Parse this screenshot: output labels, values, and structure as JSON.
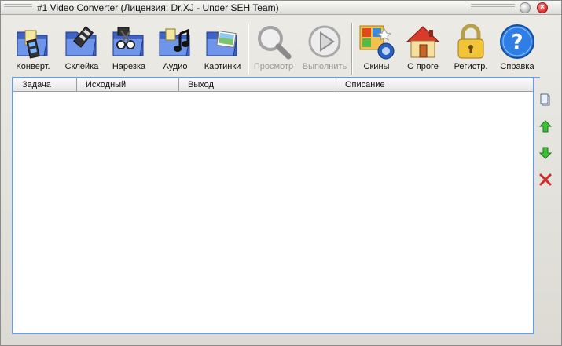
{
  "window": {
    "title": "#1 Video Converter (Лицензия: Dr.XJ - Under SEH Team)"
  },
  "toolbar": {
    "convert": "Конверт.",
    "join": "Склейка",
    "cut": "Нарезка",
    "audio": "Аудио",
    "images": "Картинки",
    "preview": "Просмотр",
    "run": "Выполнить",
    "skins": "Скины",
    "about": "О проге",
    "register": "Регистр.",
    "help": "Справка"
  },
  "task_list": {
    "columns": [
      "Задача",
      "Исходный",
      "Выход",
      "Описание"
    ]
  },
  "colors": {
    "accent": "#6f9ad6",
    "disabled_text": "#9a9a9a",
    "close_button": "#e23a3a"
  }
}
